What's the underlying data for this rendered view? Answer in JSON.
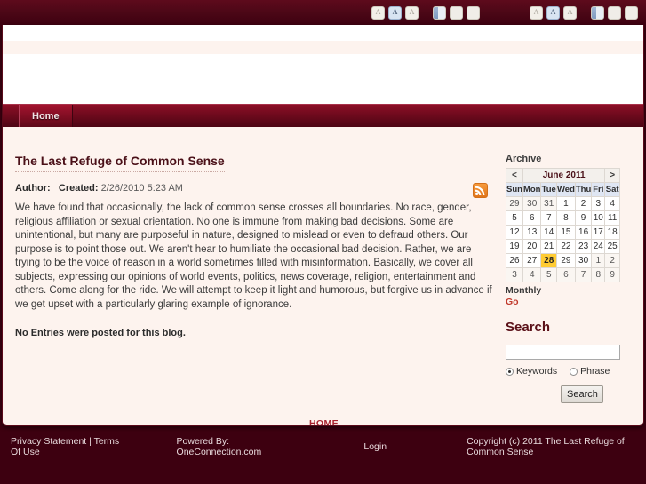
{
  "toolbar": {
    "text_size_buttons": [
      {
        "label": "A",
        "size": "small",
        "selected": false
      },
      {
        "label": "A",
        "size": "medium",
        "selected": true
      },
      {
        "label": "A",
        "size": "large",
        "selected": false
      }
    ],
    "layout_buttons": [
      {
        "name": "layout-narrow",
        "active": true
      },
      {
        "name": "layout-medium",
        "active": false
      },
      {
        "name": "layout-wide",
        "active": false
      }
    ]
  },
  "nav": {
    "tabs": [
      {
        "label": "Home",
        "active": true
      }
    ]
  },
  "post": {
    "title": "The Last Refuge of Common Sense",
    "author_label": "Author:",
    "author_name": "",
    "created_label": "Created:",
    "created_date": "2/26/2010 5:23 AM",
    "body": "We have found that occasionally, the lack of common sense crosses all boundaries. No race, gender, religious affiliation or sexual orientation. No one is immune from making bad decisions. Some are unintentional, but many are purposeful in nature, designed to mislead or even to defraud others. Our purpose is to point those out. We aren't hear to humiliate the occasional bad decision. Rather, we are trying to be the voice of reason in a world sometimes filled with misinformation. Basically, we cover all subjects, expressing our opinions of world events, politics, news coverage, religion, entertainment and others. Come along for the ride. We will attempt to keep it light and humorous, but forgive us in advance if we get upset with a particularly glaring example of ignorance.",
    "no_entries": "No Entries were posted for this blog.",
    "rss_icon": "rss-feed-icon"
  },
  "sidebar": {
    "archive": {
      "heading": "Archive",
      "prev_label": "<",
      "next_label": ">",
      "month_label": "June 2011",
      "day_headers": [
        "Sun",
        "Mon",
        "Tue",
        "Wed",
        "Thu",
        "Fri",
        "Sat"
      ],
      "weeks": [
        [
          {
            "d": "29",
            "o": true
          },
          {
            "d": "30",
            "o": true
          },
          {
            "d": "31",
            "o": true
          },
          {
            "d": "1"
          },
          {
            "d": "2"
          },
          {
            "d": "3"
          },
          {
            "d": "4"
          }
        ],
        [
          {
            "d": "5"
          },
          {
            "d": "6"
          },
          {
            "d": "7"
          },
          {
            "d": "8"
          },
          {
            "d": "9"
          },
          {
            "d": "10"
          },
          {
            "d": "11"
          }
        ],
        [
          {
            "d": "12"
          },
          {
            "d": "13"
          },
          {
            "d": "14"
          },
          {
            "d": "15"
          },
          {
            "d": "16"
          },
          {
            "d": "17"
          },
          {
            "d": "18"
          }
        ],
        [
          {
            "d": "19"
          },
          {
            "d": "20"
          },
          {
            "d": "21"
          },
          {
            "d": "22"
          },
          {
            "d": "23"
          },
          {
            "d": "24"
          },
          {
            "d": "25"
          }
        ],
        [
          {
            "d": "26"
          },
          {
            "d": "27"
          },
          {
            "d": "28",
            "s": true
          },
          {
            "d": "29"
          },
          {
            "d": "30"
          },
          {
            "d": "1",
            "o": true
          },
          {
            "d": "2",
            "o": true
          }
        ],
        [
          {
            "d": "3",
            "o": true
          },
          {
            "d": "4",
            "o": true
          },
          {
            "d": "5",
            "o": true
          },
          {
            "d": "6",
            "o": true
          },
          {
            "d": "7",
            "o": true
          },
          {
            "d": "8",
            "o": true
          },
          {
            "d": "9",
            "o": true
          }
        ]
      ],
      "monthly_label": "Monthly",
      "go_label": "Go"
    },
    "search": {
      "heading": "Search",
      "input_value": "",
      "input_placeholder": "",
      "option_keywords": "Keywords",
      "option_phrase": "Phrase",
      "selected_option": "Keywords",
      "button_label": "Search"
    }
  },
  "bottom": {
    "home_link": "HOME"
  },
  "footer": {
    "privacy": "Privacy Statement",
    "separator": "|",
    "terms": "Terms Of Use",
    "powered_by": "Powered By: OneConnection.com",
    "login": "Login",
    "copyright": "Copyright (c) 2011 The Last Refuge of Common Sense"
  },
  "colors": {
    "brand_dark": "#3d0010",
    "brand_nav": "#6d0a1d",
    "content_bg": "#fdf3ee",
    "accent_red": "#a8232f",
    "calendar_selected": "#ffcc33",
    "calendar_header": "#dfe6f3"
  }
}
